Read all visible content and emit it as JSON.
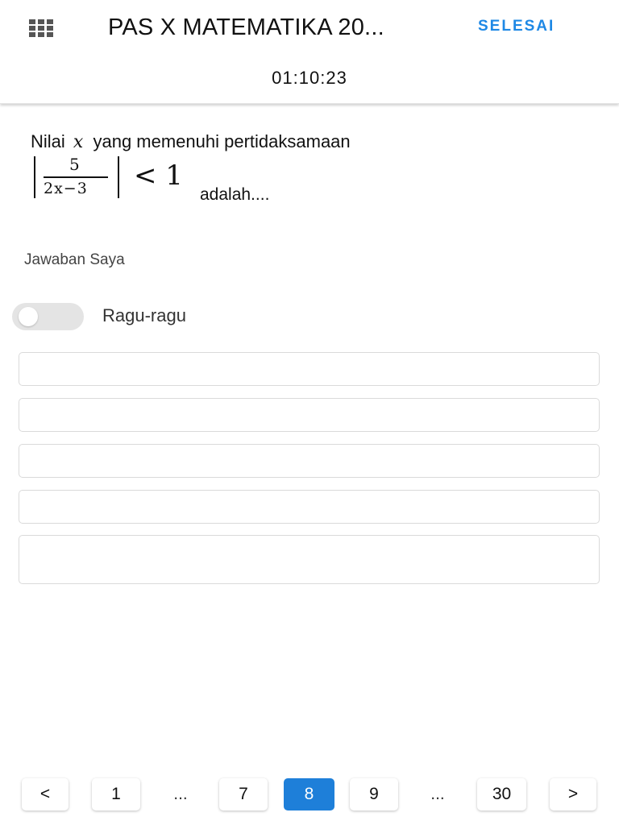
{
  "header": {
    "title": "PAS X MATEMATIKA 20...",
    "finish_label": "SELESAI",
    "menu_icon": "grid-icon",
    "timer": "01:10:23"
  },
  "question": {
    "line1_before": "Nilai",
    "variable": "x",
    "line1_after": "yang memenuhi pertidaksamaan",
    "formula": {
      "numerator": "5",
      "denominator": "2x−3",
      "relation": "< 1"
    },
    "line_end": "adalah...."
  },
  "answer": {
    "label": "Jawaban Saya",
    "doubt_toggle_label": "Ragu-ragu",
    "doubt_toggle_on": false,
    "options": [
      "",
      "",
      "",
      "",
      ""
    ]
  },
  "pagination": {
    "prev_label": "<",
    "next_label": ">",
    "pages": [
      "1",
      "...",
      "7",
      "8",
      "9",
      "...",
      "30"
    ],
    "current": "8",
    "accent_color": "#1e7fd9"
  }
}
